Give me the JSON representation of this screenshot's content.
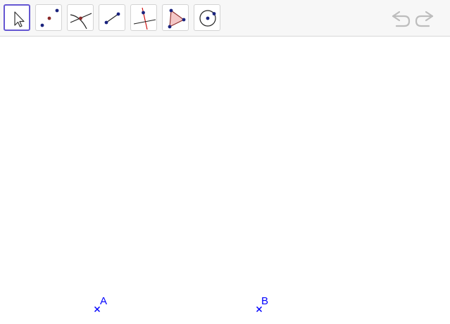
{
  "toolbar": {
    "tools": [
      {
        "name": "move",
        "icon": "move-arrow-icon",
        "selected": true
      },
      {
        "name": "point",
        "icon": "point-icon",
        "selected": false
      },
      {
        "name": "intersect",
        "icon": "intersect-icon",
        "selected": false
      },
      {
        "name": "segment",
        "icon": "segment-icon",
        "selected": false
      },
      {
        "name": "perpendicular-bisector",
        "icon": "perpendicular-bisector-icon",
        "selected": false
      },
      {
        "name": "polygon",
        "icon": "polygon-icon",
        "selected": false
      },
      {
        "name": "circle-center-point",
        "icon": "circle-icon",
        "selected": false
      }
    ],
    "undo_icon": "undo-icon",
    "redo_icon": "redo-icon"
  },
  "canvas": {
    "points": [
      {
        "label": "A"
      },
      {
        "label": "B"
      }
    ]
  },
  "colors": {
    "accent": "#6557d2",
    "point": "#0000ff",
    "icon_dot": "#1a237e",
    "icon_red": "#cc0000",
    "polygon_fill": "#f4c7c7",
    "disabled": "#bdbdbd"
  }
}
